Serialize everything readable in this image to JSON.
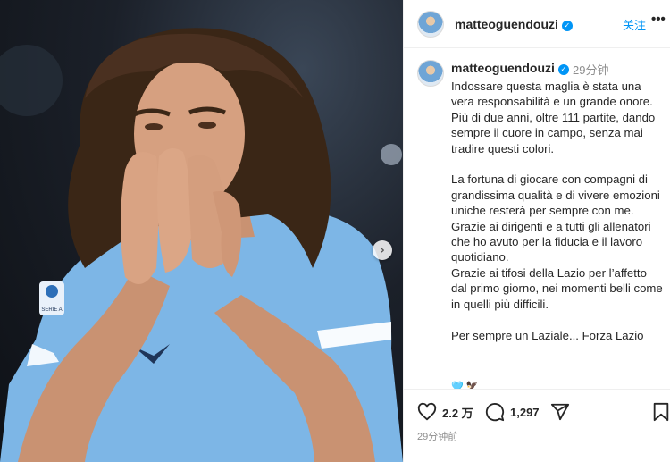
{
  "header": {
    "username": "matteoguendouzi",
    "follow_label": "关注",
    "more_label": "•••"
  },
  "caption": {
    "username": "matteoguendouzi",
    "time": "29分钟",
    "text": "Indossare questa maglia è stata una vera responsabilità e un grande onore.\nPiù di due anni, oltre 111 partite, dando sempre il cuore in campo, senza mai tradire questi colori.\n\nLa fortuna di giocare con compagni di grandissima qualità e di vivere emozioni uniche resterà per sempre con me.\nGrazie ai dirigenti e a tutti gli allenatori che ho avuto per la fiducia e il lavoro quotidiano.\nGrazie ai tifosi della Lazio per l’affetto dal primo giorno, nei momenti belli come in quelli più difficili.\n\nPer sempre un Laziale... Forza Lazio",
    "emoji": "🩵 🦅"
  },
  "actions": {
    "likes": "2.2 万",
    "comments": "1,297",
    "post_time": "29分钟前"
  },
  "photo": {
    "patch_text": "SERIE A",
    "jersey_color": "#7db6e6",
    "carousel_next": "›"
  },
  "colors": {
    "accent": "#0095f6",
    "muted": "#8e8e8e",
    "text": "#262626"
  },
  "icons": [
    "heart-icon",
    "comment-icon",
    "share-icon",
    "bookmark-icon",
    "verified-icon",
    "chevron-right-icon"
  ]
}
